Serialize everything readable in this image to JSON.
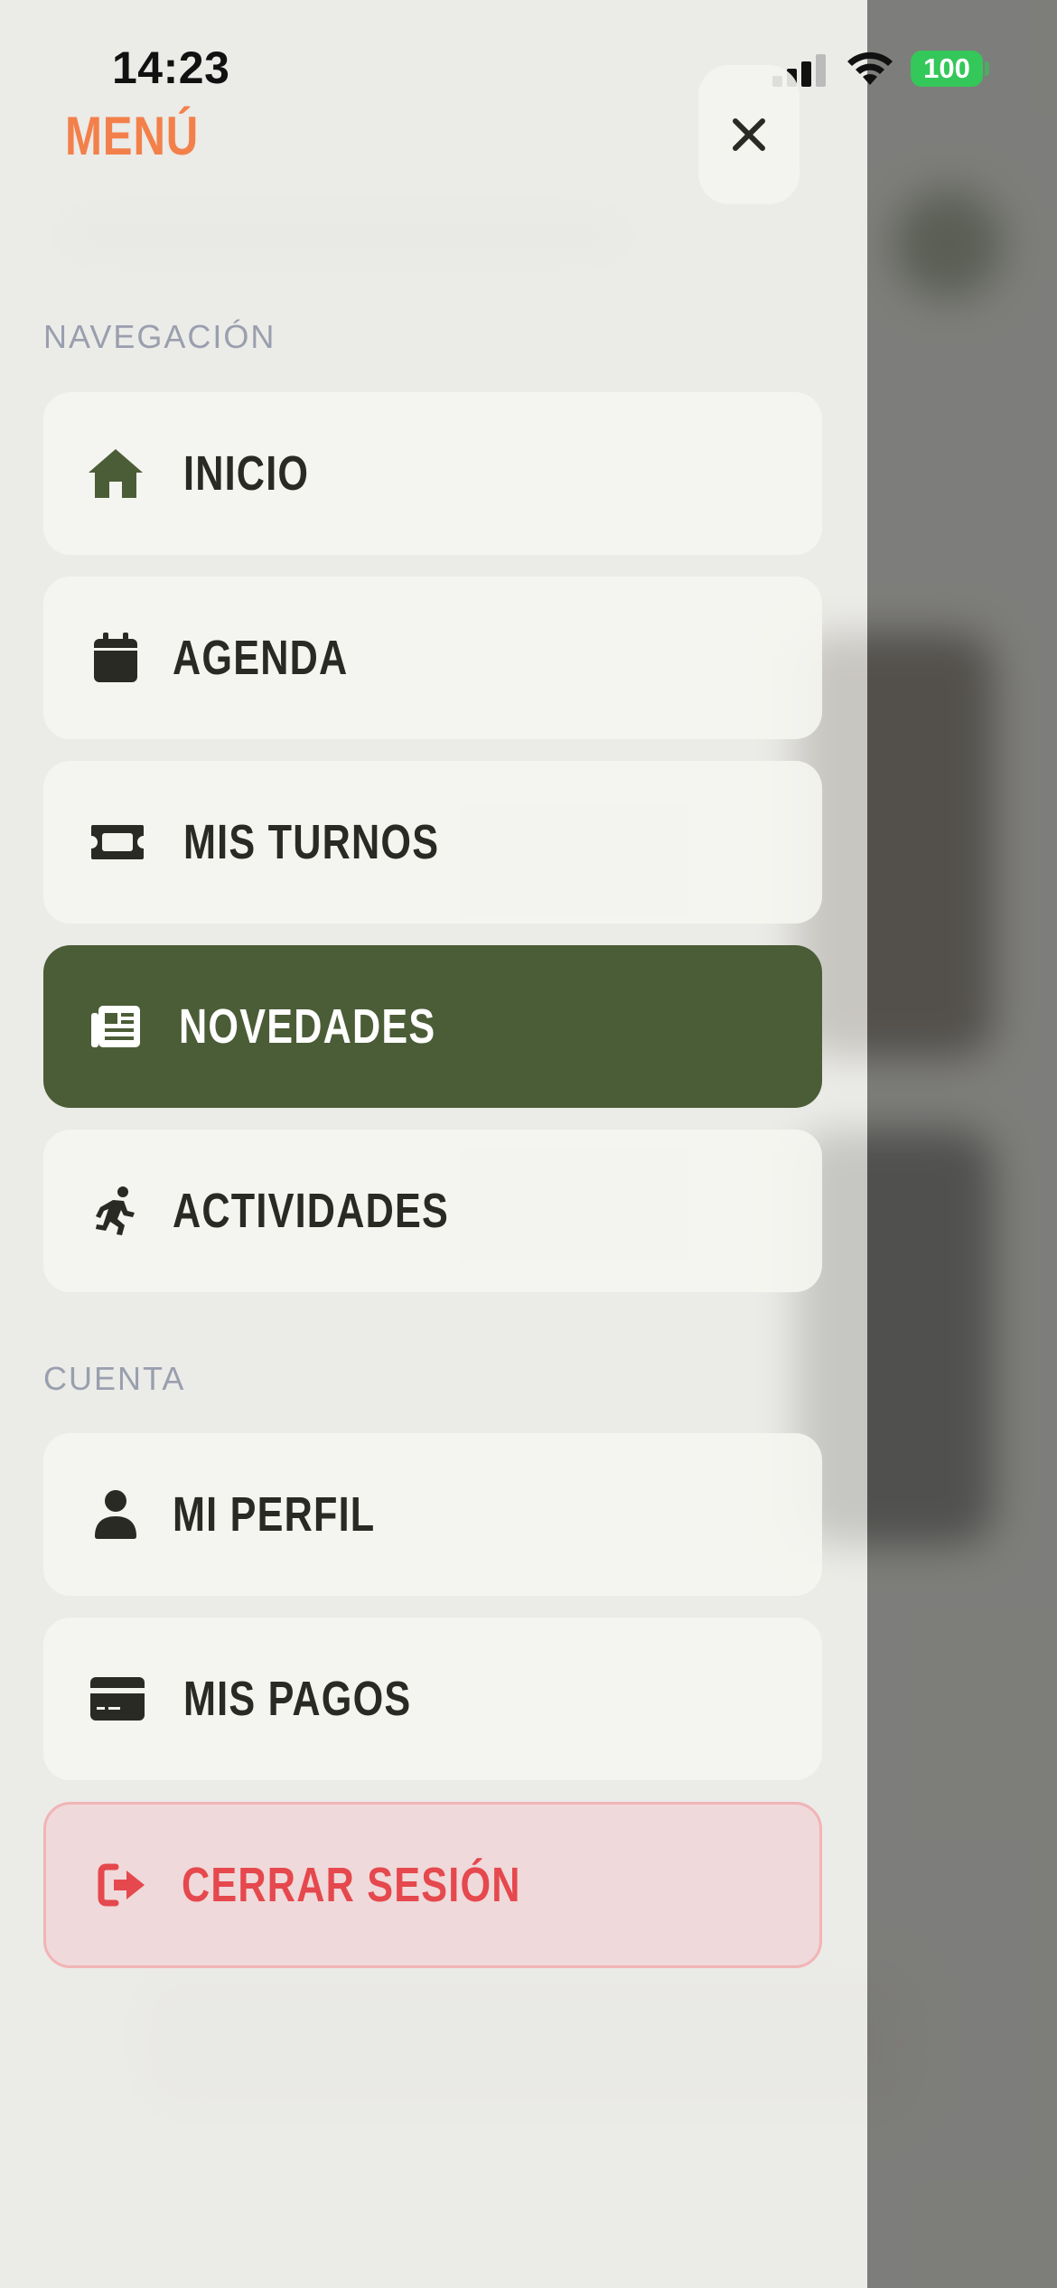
{
  "status_bar": {
    "time": "14:23",
    "battery": "100"
  },
  "header": {
    "title": "MENÚ",
    "close_icon": "close-icon"
  },
  "sections": {
    "navigation": {
      "label": "NAVEGACIÓN",
      "items": [
        {
          "label": "INICIO",
          "icon": "home-icon",
          "active": false
        },
        {
          "label": "AGENDA",
          "icon": "calendar-icon",
          "active": false
        },
        {
          "label": "MIS TURNOS",
          "icon": "ticket-icon",
          "active": false
        },
        {
          "label": "NOVEDADES",
          "icon": "newspaper-icon",
          "active": true
        },
        {
          "label": "ACTIVIDADES",
          "icon": "running-icon",
          "active": false
        }
      ]
    },
    "account": {
      "label": "CUENTA",
      "items": [
        {
          "label": "MI PERFIL",
          "icon": "user-icon"
        },
        {
          "label": "MIS PAGOS",
          "icon": "credit-card-icon"
        }
      ]
    }
  },
  "logout": {
    "label": "CERRAR SESIÓN",
    "icon": "logout-icon"
  },
  "colors": {
    "accent_orange": "#f3804b",
    "active_green": "#4b5d37",
    "home_icon_green": "#4b5d37",
    "logout_red": "#e5484d",
    "battery_green": "#34c759"
  }
}
